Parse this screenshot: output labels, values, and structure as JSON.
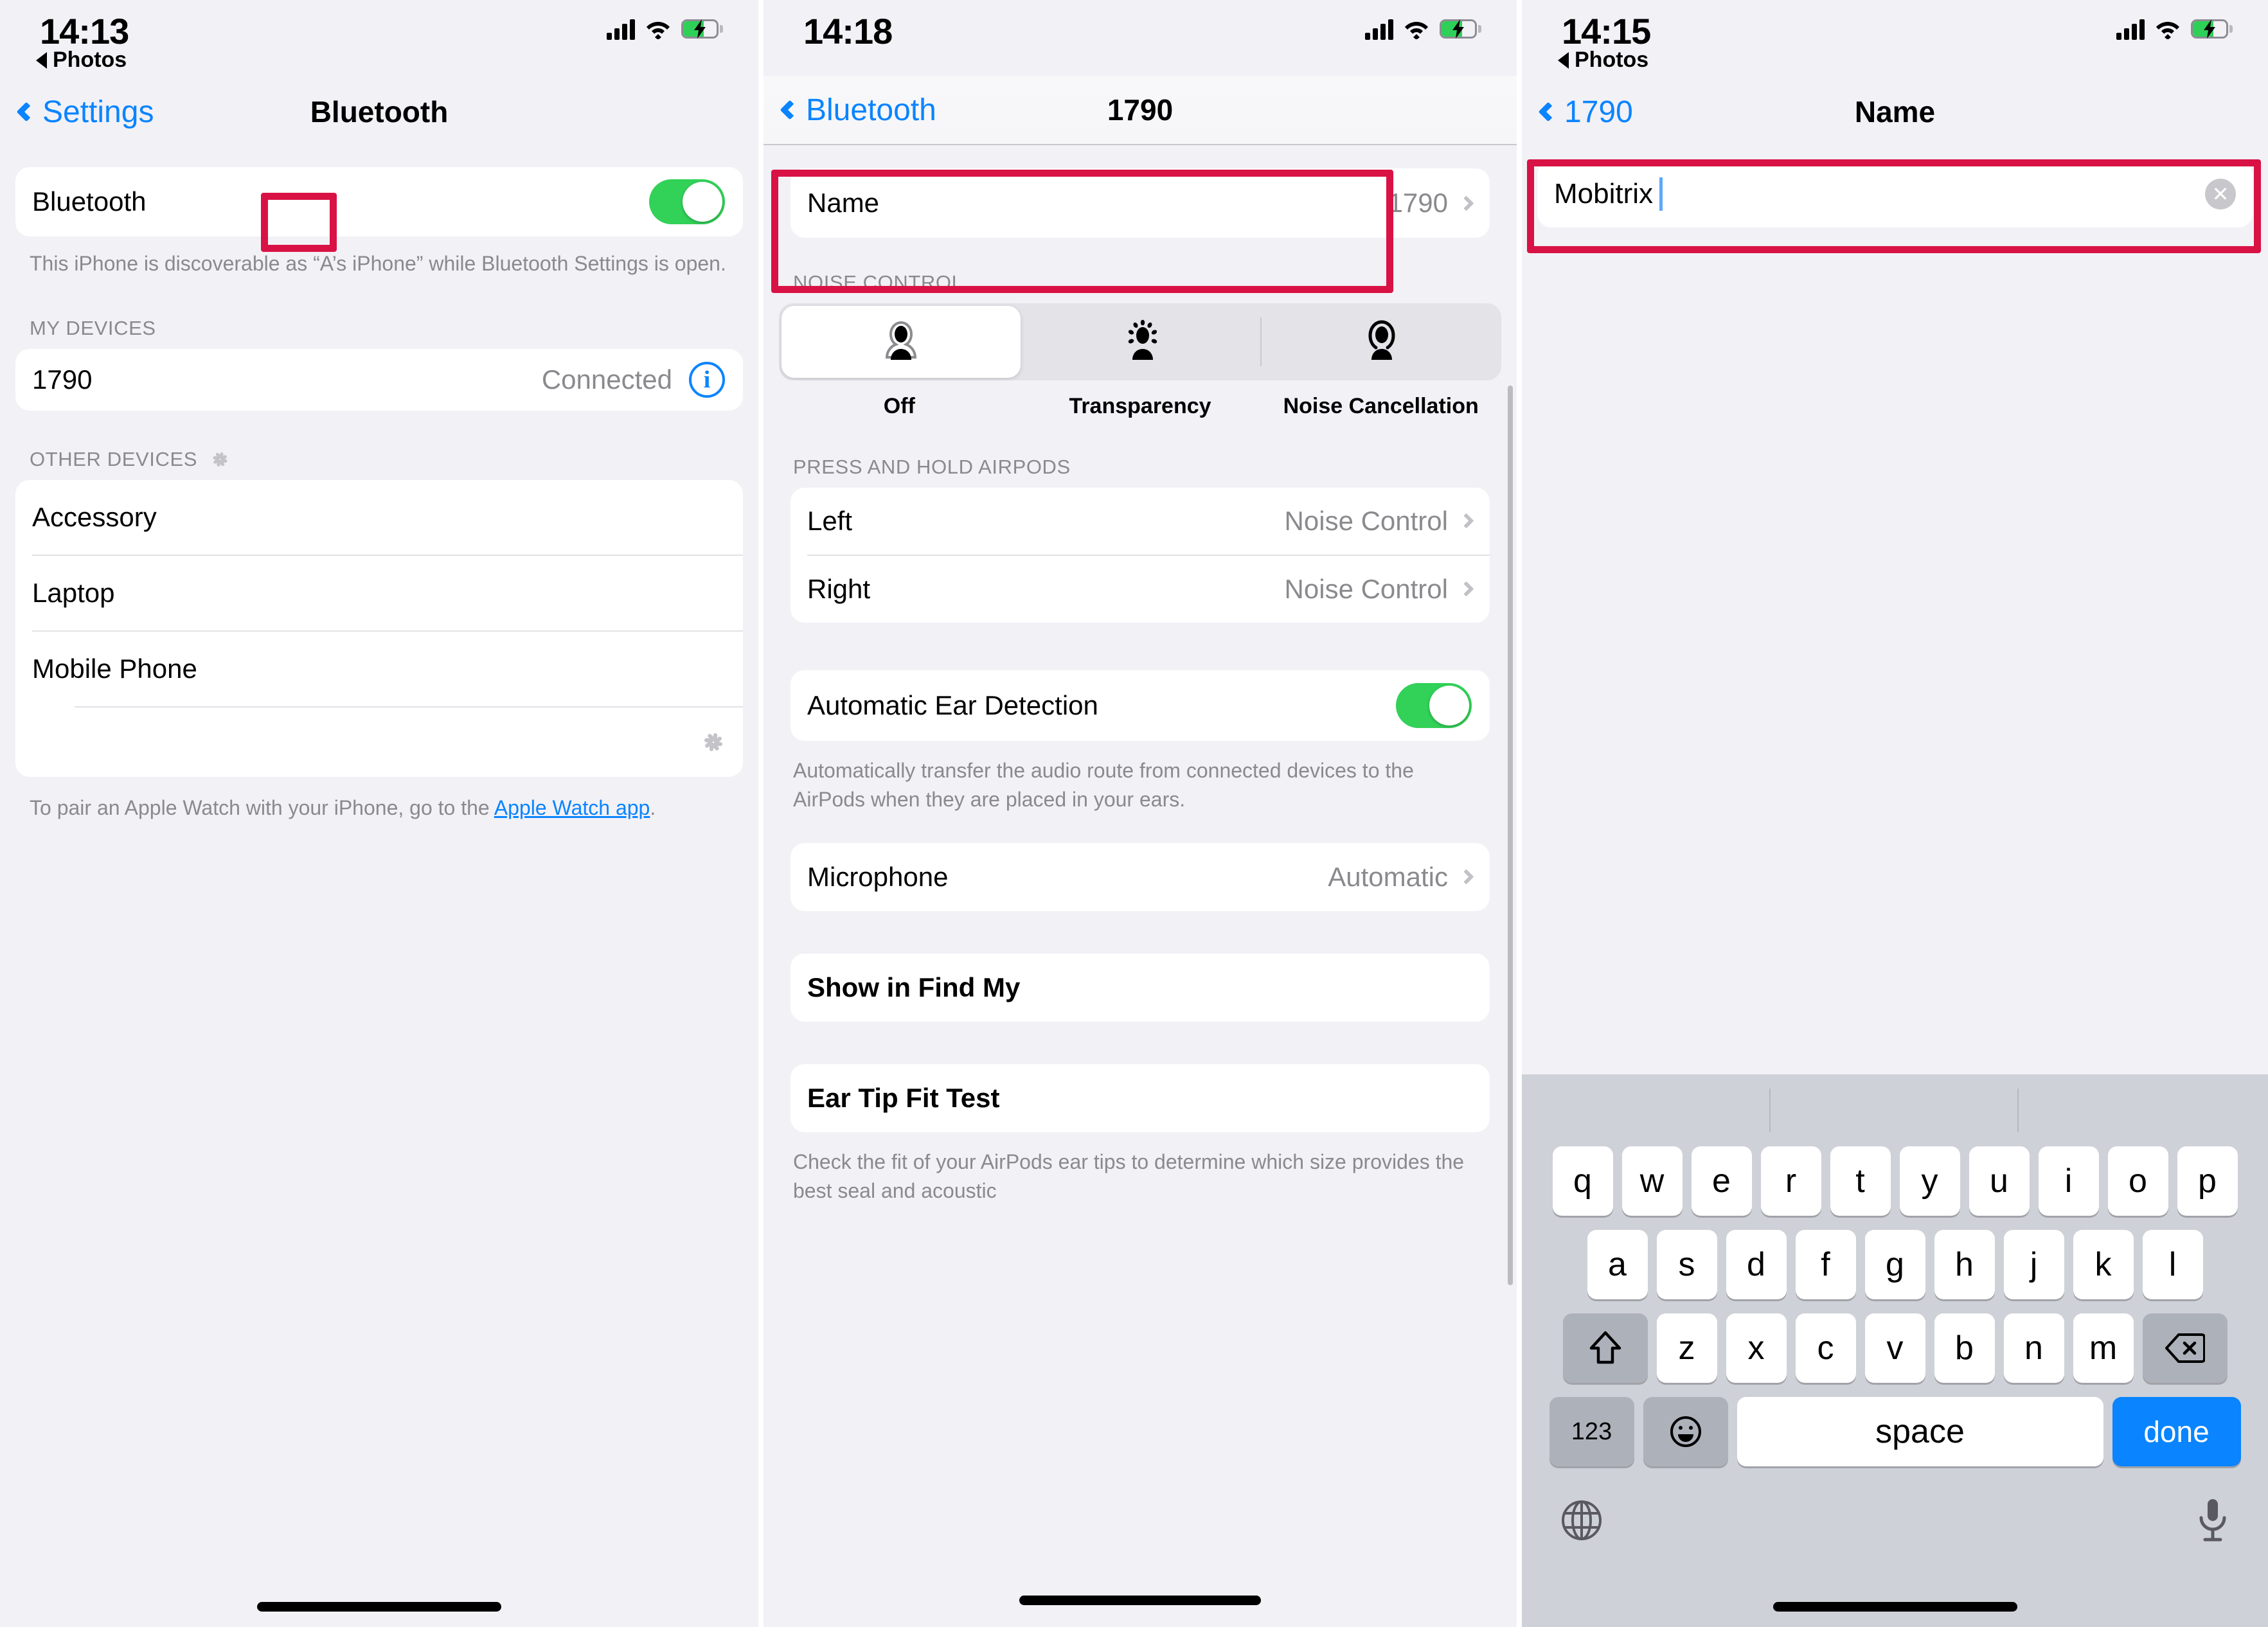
{
  "colors": {
    "accent": "#0a84ff",
    "annotation": "#d91245",
    "toggle_on": "#32d158",
    "muted": "#8a8a8e"
  },
  "phone1": {
    "status": {
      "time": "14:13",
      "back_app": "Photos"
    },
    "nav": {
      "back_label": "Settings",
      "title": "Bluetooth"
    },
    "bluetooth_row": {
      "label": "Bluetooth",
      "state": "on"
    },
    "discoverable_note": "This iPhone is discoverable as “A’s iPhone” while Bluetooth Settings is open.",
    "my_devices_header": "MY DEVICES",
    "my_devices": [
      {
        "name": "1790",
        "status": "Connected",
        "info_icon": "info-circle-icon"
      }
    ],
    "other_devices_header": "OTHER DEVICES",
    "other_devices": [
      {
        "name": "Accessory"
      },
      {
        "name": "Laptop"
      },
      {
        "name": "Mobile Phone"
      }
    ],
    "watch_note_prefix": "To pair an Apple Watch with your iPhone, go to the ",
    "watch_note_link": "Apple Watch app",
    "watch_note_suffix": "."
  },
  "phone2": {
    "status": {
      "time": "14:18"
    },
    "nav": {
      "back_label": "Bluetooth",
      "title": "1790"
    },
    "name_row": {
      "label": "Name",
      "value": "1790"
    },
    "noise_control_header": "NOISE CONTROL",
    "noise_control": {
      "options": [
        {
          "label": "Off",
          "icon": "person-off-icon",
          "selected": true
        },
        {
          "label": "Transparency",
          "icon": "person-transparency-icon",
          "selected": false
        },
        {
          "label": "Noise Cancellation",
          "icon": "person-noise-cancel-icon",
          "selected": false
        }
      ]
    },
    "press_hold_header": "PRESS AND HOLD AIRPODS",
    "press_hold": [
      {
        "label": "Left",
        "value": "Noise Control"
      },
      {
        "label": "Right",
        "value": "Noise Control"
      }
    ],
    "ear_detection": {
      "label": "Automatic Ear Detection",
      "state": "on"
    },
    "ear_detection_note": "Automatically transfer the audio route from connected devices to the AirPods when they are placed in your ears.",
    "microphone": {
      "label": "Microphone",
      "value": "Automatic"
    },
    "find_my": {
      "label": "Show in Find My"
    },
    "ear_tip_fit_test": {
      "label": "Ear Tip Fit Test"
    },
    "ear_tip_note": "Check the fit of your AirPods ear tips to determine which size provides the best seal and acoustic"
  },
  "phone3": {
    "status": {
      "time": "14:15",
      "back_app": "Photos"
    },
    "nav": {
      "back_label": "1790",
      "title": "Name"
    },
    "name_input": {
      "value": "Mobitrix",
      "clear_icon": "clear-circle-icon"
    },
    "keyboard": {
      "row1": [
        "q",
        "w",
        "e",
        "r",
        "t",
        "y",
        "u",
        "i",
        "o",
        "p"
      ],
      "row2": [
        "a",
        "s",
        "d",
        "f",
        "g",
        "h",
        "j",
        "k",
        "l"
      ],
      "row3": [
        "z",
        "x",
        "c",
        "v",
        "b",
        "n",
        "m"
      ],
      "shift_icon": "shift-arrow-icon",
      "backspace_icon": "backspace-icon",
      "numbers_label": "123",
      "emoji_icon": "emoji-smiley-icon",
      "space_label": "space",
      "return_label": "done",
      "globe_icon": "globe-icon",
      "dictation_icon": "microphone-icon"
    }
  }
}
